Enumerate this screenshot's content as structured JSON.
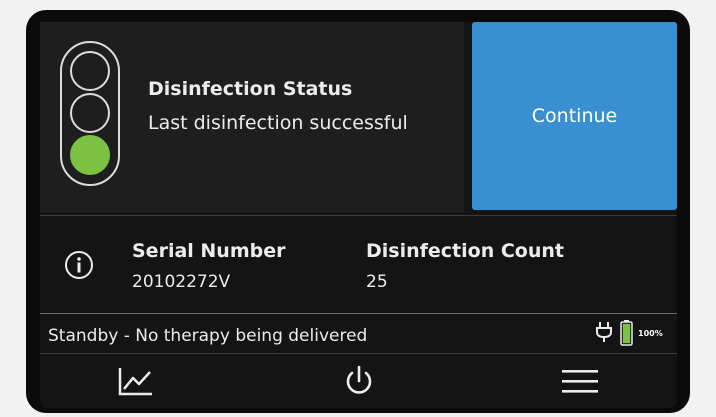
{
  "status": {
    "title": "Disinfection Status",
    "subtitle": "Last disinfection successful",
    "light_state": "green",
    "light_color": "#7cc242"
  },
  "continue_button": {
    "label": "Continue",
    "color": "#3a8fd0"
  },
  "device_info": {
    "serial_label": "Serial Number",
    "serial_value": "20102272V",
    "count_label": "Disinfection Count",
    "count_value": "25"
  },
  "status_bar": {
    "text": "Standby - No therapy being delivered",
    "battery_percent": "100%",
    "power_source": "plug-icon"
  },
  "nav": {
    "items": [
      {
        "icon": "chart-icon"
      },
      {
        "icon": "power-icon"
      },
      {
        "icon": "menu-icon"
      }
    ]
  }
}
